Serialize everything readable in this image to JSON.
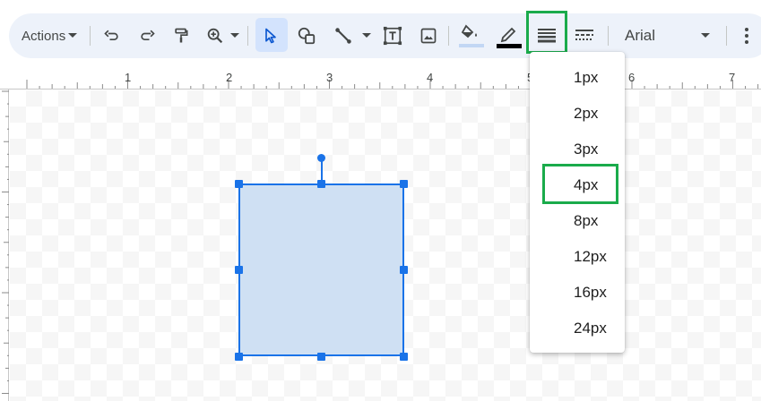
{
  "toolbar": {
    "actions_label": "Actions",
    "font_name": "Arial",
    "icons": [
      "undo-icon",
      "redo-icon",
      "paint-format-icon",
      "zoom-icon",
      "select-icon",
      "shape-icon",
      "line-icon",
      "text-box-icon",
      "image-icon",
      "fill-color-icon",
      "border-color-icon",
      "border-weight-icon",
      "border-dash-icon",
      "more-icon"
    ],
    "fill_indicator_color": "#c2d7f4",
    "border_color": "#000000",
    "highlight_color": "#1aab4b"
  },
  "ruler": {
    "labels": [
      "1",
      "2",
      "3",
      "4",
      "5",
      "6",
      "7"
    ]
  },
  "border_weight_menu": {
    "options": [
      "1px",
      "2px",
      "3px",
      "4px",
      "8px",
      "12px",
      "16px",
      "24px"
    ],
    "highlighted": "4px"
  },
  "shape": {
    "fill_color": "#cfe0f3",
    "border_color": "#1a73e8"
  }
}
